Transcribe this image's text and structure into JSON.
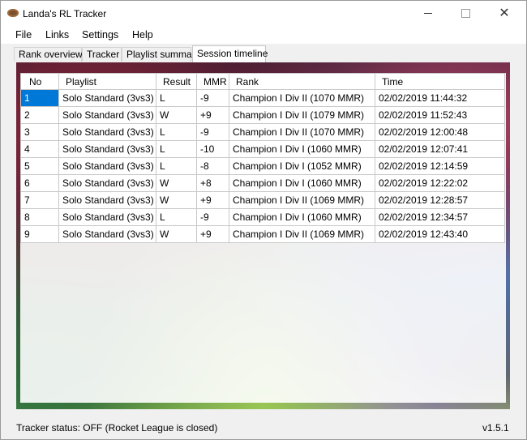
{
  "window": {
    "title": "Landa's RL Tracker",
    "icon": "rugby-ball-icon"
  },
  "menu": [
    "File",
    "Links",
    "Settings",
    "Help"
  ],
  "tabs": [
    "Rank overview",
    "Tracker",
    "Playlist summary",
    "Session timeline"
  ],
  "active_tab": "Session timeline",
  "table": {
    "headers": [
      "No",
      "Playlist",
      "Result",
      "MMR",
      "Rank",
      "Time"
    ],
    "rows": [
      [
        "1",
        "Solo Standard (3vs3)",
        "L",
        "-9",
        "Champion I Div II (1070 MMR)",
        "02/02/2019 11:44:32"
      ],
      [
        "2",
        "Solo Standard (3vs3)",
        "W",
        "+9",
        "Champion I Div II (1079 MMR)",
        "02/02/2019 11:52:43"
      ],
      [
        "3",
        "Solo Standard (3vs3)",
        "L",
        "-9",
        "Champion I Div II (1070 MMR)",
        "02/02/2019 12:00:48"
      ],
      [
        "4",
        "Solo Standard (3vs3)",
        "L",
        "-10",
        "Champion I Div I (1060 MMR)",
        "02/02/2019 12:07:41"
      ],
      [
        "5",
        "Solo Standard (3vs3)",
        "L",
        "-8",
        "Champion I Div I (1052 MMR)",
        "02/02/2019 12:14:59"
      ],
      [
        "6",
        "Solo Standard (3vs3)",
        "W",
        "+8",
        "Champion I Div I (1060 MMR)",
        "02/02/2019 12:22:02"
      ],
      [
        "7",
        "Solo Standard (3vs3)",
        "W",
        "+9",
        "Champion I Div II (1069 MMR)",
        "02/02/2019 12:28:57"
      ],
      [
        "8",
        "Solo Standard (3vs3)",
        "L",
        "-9",
        "Champion I Div I (1060 MMR)",
        "02/02/2019 12:34:57"
      ],
      [
        "9",
        "Solo Standard (3vs3)",
        "W",
        "+9",
        "Champion I Div II (1069 MMR)",
        "02/02/2019 12:43:40"
      ]
    ],
    "selected_row": 0
  },
  "status": {
    "text": "Tracker status: OFF (Rocket League is closed)",
    "version": "v1.5.1"
  },
  "colors": {
    "selection": "#0078d7"
  }
}
